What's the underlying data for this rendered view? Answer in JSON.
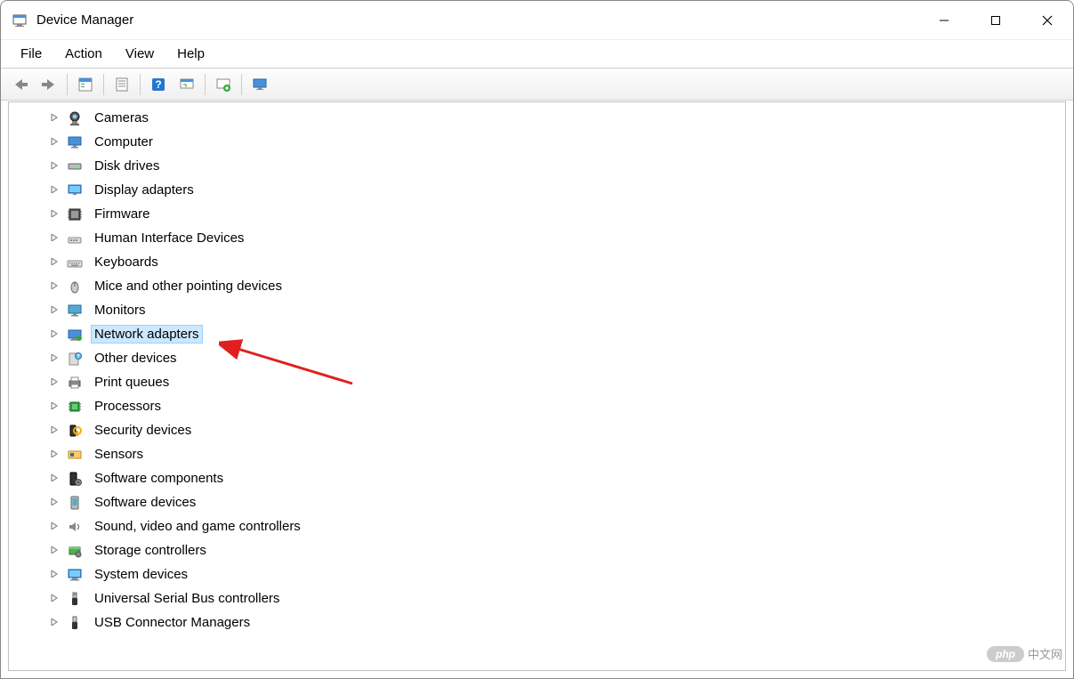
{
  "window": {
    "title": "Device Manager"
  },
  "menubar": {
    "items": [
      "File",
      "Action",
      "View",
      "Help"
    ]
  },
  "toolbar": {
    "back": "back-icon",
    "forward": "forward-icon",
    "show_hidden": "show-hidden-icon",
    "properties": "properties-icon",
    "help": "help-icon",
    "scan": "scan-icon",
    "add": "add-driver-icon",
    "monitor": "monitor-icon"
  },
  "tree": {
    "items": [
      {
        "label": "Cameras",
        "icon": "camera",
        "selected": false
      },
      {
        "label": "Computer",
        "icon": "computer",
        "selected": false
      },
      {
        "label": "Disk drives",
        "icon": "disk",
        "selected": false
      },
      {
        "label": "Display adapters",
        "icon": "display",
        "selected": false
      },
      {
        "label": "Firmware",
        "icon": "firmware",
        "selected": false
      },
      {
        "label": "Human Interface Devices",
        "icon": "hid",
        "selected": false
      },
      {
        "label": "Keyboards",
        "icon": "keyboard",
        "selected": false
      },
      {
        "label": "Mice and other pointing devices",
        "icon": "mouse",
        "selected": false
      },
      {
        "label": "Monitors",
        "icon": "monitor",
        "selected": false
      },
      {
        "label": "Network adapters",
        "icon": "network",
        "selected": true
      },
      {
        "label": "Other devices",
        "icon": "other",
        "selected": false
      },
      {
        "label": "Print queues",
        "icon": "printer",
        "selected": false
      },
      {
        "label": "Processors",
        "icon": "cpu",
        "selected": false
      },
      {
        "label": "Security devices",
        "icon": "security",
        "selected": false
      },
      {
        "label": "Sensors",
        "icon": "sensor",
        "selected": false
      },
      {
        "label": "Software components",
        "icon": "swcomp",
        "selected": false
      },
      {
        "label": "Software devices",
        "icon": "swdev",
        "selected": false
      },
      {
        "label": "Sound, video and game controllers",
        "icon": "sound",
        "selected": false
      },
      {
        "label": "Storage controllers",
        "icon": "storage",
        "selected": false
      },
      {
        "label": "System devices",
        "icon": "system",
        "selected": false
      },
      {
        "label": "Universal Serial Bus controllers",
        "icon": "usb",
        "selected": false
      },
      {
        "label": "USB Connector Managers",
        "icon": "usbconn",
        "selected": false
      }
    ]
  },
  "watermark": {
    "pill": "php",
    "text": "中文网"
  }
}
